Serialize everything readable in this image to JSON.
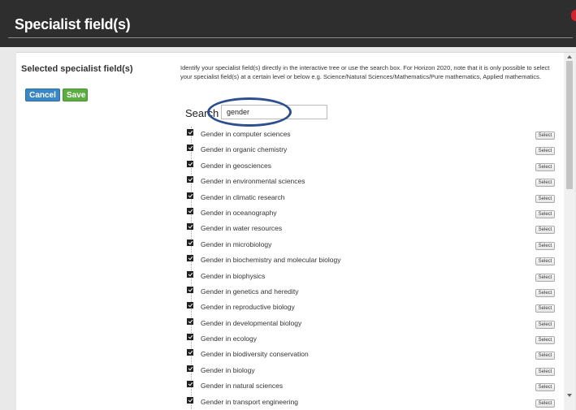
{
  "window": {
    "title": "Specialist field(s)"
  },
  "left_panel": {
    "heading": "Selected specialist field(s)",
    "cancel_label": "Cancel",
    "save_label": "Save"
  },
  "instructions": "Identify your specialist field(s) directly in the interactive tree or use the search box. For Horizon 2020, note that it is only possible to select your specialist field(s) at a certain level or below e.g. Science/Natural Sciences/Mathematics/Pure mathematics, Applied mathematics.",
  "search": {
    "label": "Search",
    "value": "gender"
  },
  "select_label": "Select",
  "results": [
    "Gender in computer sciences",
    "Gender in organic chemistry",
    "Gender in geosciences",
    "Gender in environmental sciences",
    "Gender in climatic research",
    "Gender in oceanography",
    "Gender in water resources",
    "Gender in microbiology",
    "Gender in biochemistry and molecular biology",
    "Gender in biophysics",
    "Gender in genetics and heredity",
    "Gender in reproductive biology",
    "Gender in developmental biology",
    "Gender in ecology",
    "Gender in biodiversity conservation",
    "Gender in biology",
    "Gender in natural sciences",
    "Gender in transport engineering"
  ],
  "colors": {
    "cancel": "#3a87c6",
    "save": "#5cad41",
    "titlebar": "#2e2e2e",
    "highlight": "#2d4f8d"
  }
}
